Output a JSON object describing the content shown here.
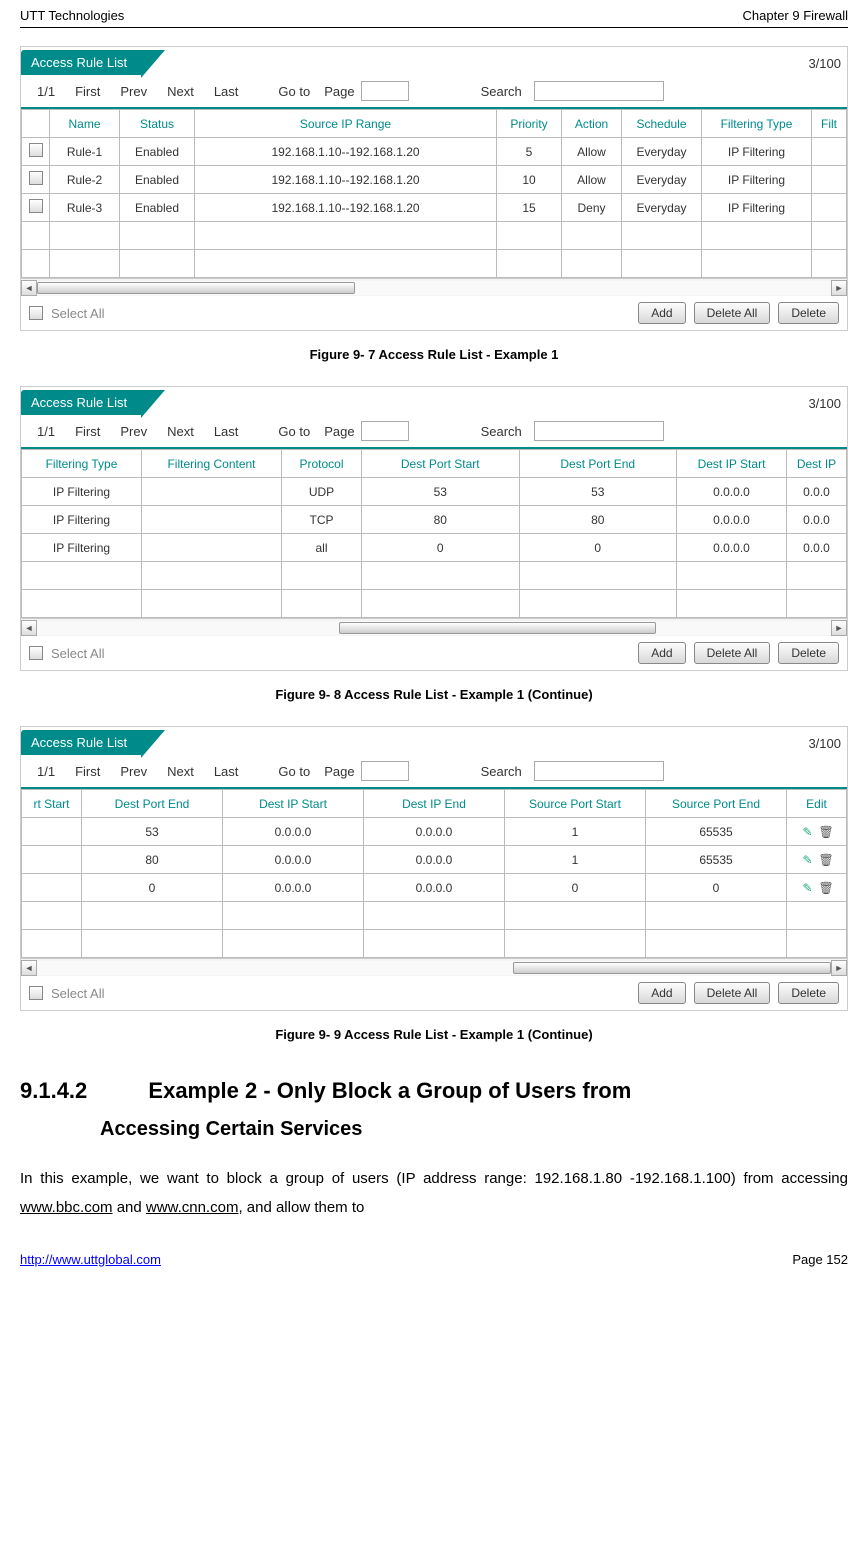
{
  "header": {
    "left": "UTT Technologies",
    "right": "Chapter 9 Firewall"
  },
  "common": {
    "tab_title": "Access Rule List",
    "count": "3/100",
    "pager": {
      "pages": "1/1",
      "first": "First",
      "prev": "Prev",
      "next": "Next",
      "last": "Last",
      "goto": "Go to",
      "page": "Page",
      "search": "Search"
    },
    "select_all": "Select All",
    "buttons": {
      "add": "Add",
      "delete_all": "Delete All",
      "delete": "Delete"
    }
  },
  "fig1": {
    "caption": "Figure 9- 7 Access Rule List - Example 1",
    "headers": [
      "",
      "Name",
      "Status",
      "Source IP Range",
      "Priority",
      "Action",
      "Schedule",
      "Filtering Type",
      "Filt"
    ],
    "rows": [
      [
        "",
        "Rule-1",
        "Enabled",
        "192.168.1.10--192.168.1.20",
        "5",
        "Allow",
        "Everyday",
        "IP Filtering",
        ""
      ],
      [
        "",
        "Rule-2",
        "Enabled",
        "192.168.1.10--192.168.1.20",
        "10",
        "Allow",
        "Everyday",
        "IP Filtering",
        ""
      ],
      [
        "",
        "Rule-3",
        "Enabled",
        "192.168.1.10--192.168.1.20",
        "15",
        "Deny",
        "Everyday",
        "IP Filtering",
        ""
      ]
    ]
  },
  "fig2": {
    "caption": "Figure 9- 8 Access Rule List - Example 1 (Continue)",
    "headers": [
      "Filtering Type",
      "Filtering Content",
      "Protocol",
      "Dest Port Start",
      "Dest Port End",
      "Dest IP Start",
      "Dest IP"
    ],
    "rows": [
      [
        "IP Filtering",
        "",
        "UDP",
        "53",
        "53",
        "0.0.0.0",
        "0.0.0"
      ],
      [
        "IP Filtering",
        "",
        "TCP",
        "80",
        "80",
        "0.0.0.0",
        "0.0.0"
      ],
      [
        "IP Filtering",
        "",
        "all",
        "0",
        "0",
        "0.0.0.0",
        "0.0.0"
      ]
    ]
  },
  "fig3": {
    "caption": "Figure 9- 9 Access Rule List - Example 1 (Continue)",
    "headers": [
      "rt Start",
      "Dest Port End",
      "Dest IP Start",
      "Dest IP End",
      "Source Port Start",
      "Source Port End",
      "Edit"
    ],
    "rows": [
      [
        "",
        "53",
        "0.0.0.0",
        "0.0.0.0",
        "1",
        "65535",
        ""
      ],
      [
        "",
        "80",
        "0.0.0.0",
        "0.0.0.0",
        "1",
        "65535",
        ""
      ],
      [
        "",
        "0",
        "0.0.0.0",
        "0.0.0.0",
        "0",
        "0",
        ""
      ]
    ]
  },
  "section": {
    "num": "9.1.4.2",
    "title_line1": "Example 2 - Only Block a Group of Users from",
    "title_line2": "Accessing Certain Services",
    "body_pre": "In this example, we want to block a group of users (IP address range: 192.168.1.80 -192.168.1.100) from accessing ",
    "link1": "www.bbc.com",
    "body_mid": " and ",
    "link2": "www.cnn.com",
    "body_post": ", and allow them to"
  },
  "footer": {
    "link": "http://www.uttglobal.com",
    "page": "Page 152"
  }
}
